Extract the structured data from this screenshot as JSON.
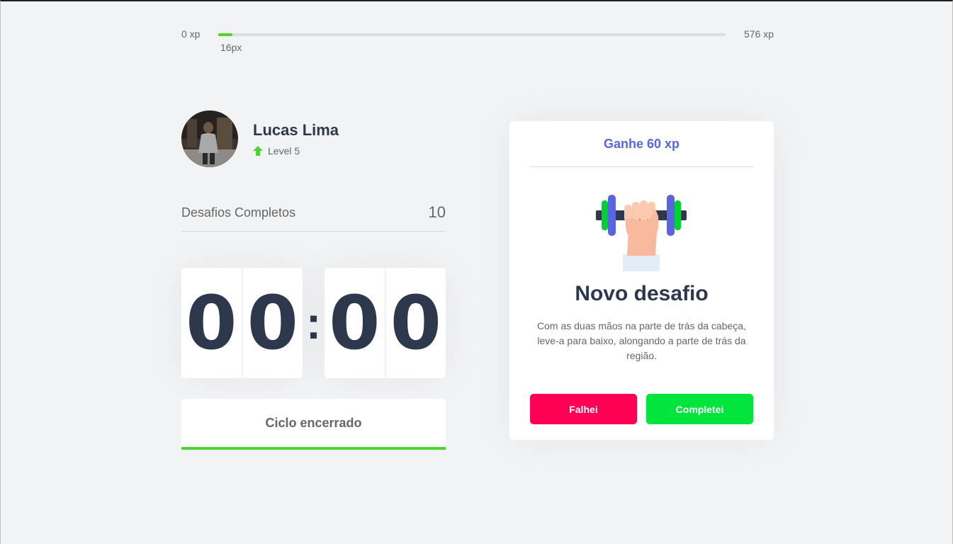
{
  "xp": {
    "min_label": "0 xp",
    "max_label": "576 xp",
    "current_label": "16px",
    "current_value": 16,
    "max_value": 576,
    "fill_color": "#4cd62b"
  },
  "profile": {
    "name": "Lucas Lima",
    "level_label": "Level 5",
    "level_icon": "level-up-arrow-icon"
  },
  "challenges": {
    "label": "Desafios Completos",
    "count": "10"
  },
  "countdown": {
    "minutes_left": "0",
    "minutes_right": "0",
    "separator": ":",
    "seconds_left": "0",
    "seconds_right": "0"
  },
  "cycle": {
    "button_label": "Ciclo encerrado",
    "bar_color": "#4cd62b"
  },
  "challenge_card": {
    "reward": "Ganhe 60 xp",
    "illustration_icon": "dumbbell-body-icon",
    "title": "Novo desafio",
    "description": "Com as duas mãos na parte de trás da cabeça, leve-a para baixo, alongando a parte de trás da região.",
    "fail_label": "Falhei",
    "success_label": "Completei",
    "fail_color": "#ff0055",
    "success_color": "#00e43c",
    "accent_color": "#5965e0"
  }
}
